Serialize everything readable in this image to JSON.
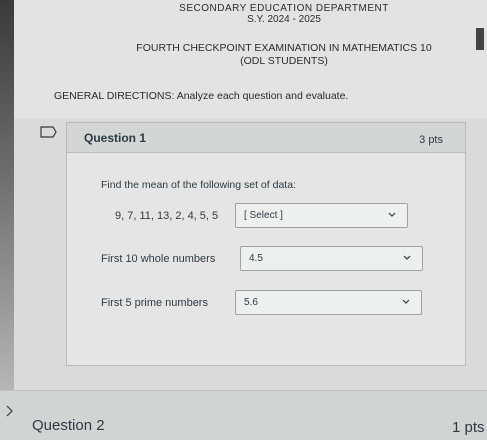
{
  "header": {
    "department": "SECONDARY EDUCATION DEPARTMENT",
    "school_year": "S.Y. 2024 - 2025",
    "exam_title": "FOURTH CHECKPOINT EXAMINATION IN MATHEMATICS 10",
    "audience": "(ODL STUDENTS)",
    "directions": "GENERAL DIRECTIONS: Analyze each question and evaluate."
  },
  "question1": {
    "title": "Question 1",
    "points": "3 pts",
    "prompt": "Find the mean of the following set of data:",
    "items": [
      {
        "label": "9, 7, 11, 13, 2, 4, 5, 5",
        "selected": "[ Select ]"
      },
      {
        "label": "First 10 whole numbers",
        "selected": "4.5"
      },
      {
        "label": "First 5 prime numbers",
        "selected": "5.6"
      }
    ]
  },
  "question2": {
    "title": "Question 2",
    "points": "1 pts"
  },
  "icons": {
    "flag": "flag-icon",
    "chevron": "chevron-down-icon"
  }
}
